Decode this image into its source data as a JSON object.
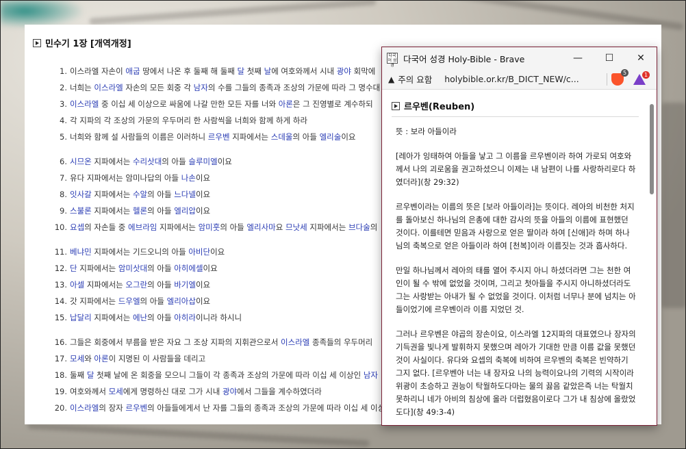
{
  "main": {
    "chapter_title": "민수기 1장 [개역개정]",
    "verses": [
      {
        "n": "1.",
        "segs": [
          [
            "이스라엘 자손이 ",
            0
          ],
          [
            "애굽",
            1
          ],
          [
            " 땅에서 나온 후 둘째 해 둘째 ",
            0
          ],
          [
            "달",
            1
          ],
          [
            " 첫째 ",
            0
          ],
          [
            "날",
            1
          ],
          [
            "에 여호와께서 시내 ",
            0
          ],
          [
            "광야",
            1
          ],
          [
            " 회막에",
            0
          ]
        ]
      },
      {
        "n": "2.",
        "segs": [
          [
            "너희는 ",
            0
          ],
          [
            "이스라엘",
            1
          ],
          [
            " 자손의 모든 회중 각 ",
            0
          ],
          [
            "남자",
            1
          ],
          [
            "의 수를 그들의 종족과 조상의 가문에 따라 그 명수대",
            0
          ]
        ]
      },
      {
        "n": "3.",
        "segs": [
          [
            "이스라엘",
            1
          ],
          [
            " 중 이십 세 이상으로 싸움에 나갈 만한 모든 자를 너와 ",
            0
          ],
          [
            "아론",
            1
          ],
          [
            "은 그 진영별로 계수하되",
            0
          ]
        ]
      },
      {
        "n": "4.",
        "segs": [
          [
            "각 지파의 각 조상의 가문의 우두머리 한 사람씩을 너희와 함께 하게 하라",
            0
          ]
        ]
      },
      {
        "n": "5.",
        "segs": [
          [
            "너희와 함께 설 사람들의 이름은 이러하니 ",
            0
          ],
          [
            "르우벤",
            1
          ],
          [
            " 지파에서는 ",
            0
          ],
          [
            "스데울",
            1
          ],
          [
            "의 아들 ",
            0
          ],
          [
            "엘리술",
            1
          ],
          [
            "이요",
            0
          ]
        ]
      },
      {
        "n": "6.",
        "segs": [
          [
            "시므온",
            1
          ],
          [
            " 지파에서는 ",
            0
          ],
          [
            "수리삿대",
            1
          ],
          [
            "의 아들 ",
            0
          ],
          [
            "슬루미엘",
            1
          ],
          [
            "이요",
            0
          ]
        ]
      },
      {
        "n": "7.",
        "segs": [
          [
            "유다 지파에서는 암미나답의 아들 ",
            0
          ],
          [
            "나손",
            1
          ],
          [
            "이요",
            0
          ]
        ]
      },
      {
        "n": "8.",
        "segs": [
          [
            "잇사갈",
            1
          ],
          [
            " 지파에서는 ",
            0
          ],
          [
            "수알",
            1
          ],
          [
            "의 아들 ",
            0
          ],
          [
            "느다넬",
            1
          ],
          [
            "이요",
            0
          ]
        ]
      },
      {
        "n": "9.",
        "segs": [
          [
            "스불론",
            1
          ],
          [
            " 지파에서는 ",
            0
          ],
          [
            "헬론",
            1
          ],
          [
            "의 아들 ",
            0
          ],
          [
            "엘리압",
            1
          ],
          [
            "이요",
            0
          ]
        ]
      },
      {
        "n": "10.",
        "segs": [
          [
            "요셉",
            1
          ],
          [
            "의 자손들 중 ",
            0
          ],
          [
            "에브라임",
            1
          ],
          [
            " 지파에서는 ",
            0
          ],
          [
            "암미훗",
            1
          ],
          [
            "의 아들 ",
            0
          ],
          [
            "엘리사마",
            1
          ],
          [
            "요 ",
            0
          ],
          [
            "므낫세",
            1
          ],
          [
            " 지파에서는 ",
            0
          ],
          [
            "브다술",
            1
          ],
          [
            "의",
            0
          ]
        ]
      },
      {
        "n": "11.",
        "segs": [
          [
            "베냐민",
            1
          ],
          [
            " 지파에서는 기드오니의 아들 ",
            0
          ],
          [
            "아비단",
            1
          ],
          [
            "이요",
            0
          ]
        ]
      },
      {
        "n": "12.",
        "segs": [
          [
            "단",
            1
          ],
          [
            " 지파에서는 ",
            0
          ],
          [
            "암미삿대",
            1
          ],
          [
            "의 아들 ",
            0
          ],
          [
            "아히에셀",
            1
          ],
          [
            "이요",
            0
          ]
        ]
      },
      {
        "n": "13.",
        "segs": [
          [
            "아셀",
            1
          ],
          [
            " 지파에서는 ",
            0
          ],
          [
            "오그란",
            1
          ],
          [
            "의 아들 ",
            0
          ],
          [
            "바기엘",
            1
          ],
          [
            "이요",
            0
          ]
        ]
      },
      {
        "n": "14.",
        "segs": [
          [
            "갓 지파에서는 ",
            0
          ],
          [
            "드우엘",
            1
          ],
          [
            "의 아들 ",
            0
          ],
          [
            "엘리아삽",
            1
          ],
          [
            "이요",
            0
          ]
        ]
      },
      {
        "n": "15.",
        "segs": [
          [
            "납달리",
            1
          ],
          [
            " 지파에서는 ",
            0
          ],
          [
            "에난",
            1
          ],
          [
            "의 아들 ",
            0
          ],
          [
            "아히라",
            1
          ],
          [
            "이니라 하시니",
            0
          ]
        ]
      },
      {
        "n": "16.",
        "segs": [
          [
            "그들은 회중에서 부름을 받은 자요 그 조상 지파의 지휘관으로서 ",
            0
          ],
          [
            "이스라엘",
            1
          ],
          [
            " 종족들의 우두머리",
            0
          ]
        ]
      },
      {
        "n": "17.",
        "segs": [
          [
            "모세",
            1
          ],
          [
            "와 ",
            0
          ],
          [
            "아론",
            1
          ],
          [
            "이 지명된 이 사람들을 데리고",
            0
          ]
        ]
      },
      {
        "n": "18.",
        "segs": [
          [
            "둘째 ",
            0
          ],
          [
            "달",
            1
          ],
          [
            " 첫째 날에 온 회중을 모으니 그들이 각 종족과 조상의 가문에 따라 이십 세 이상인 ",
            0
          ],
          [
            "남자",
            1
          ]
        ]
      },
      {
        "n": "19.",
        "segs": [
          [
            "여호와께서 ",
            0
          ],
          [
            "모세",
            1
          ],
          [
            "에게 명령하신 대로 그가 시내 ",
            0
          ],
          [
            "광야",
            1
          ],
          [
            "에서 그들을 계수하였더라",
            0
          ]
        ]
      },
      {
        "n": "20.",
        "segs": [
          [
            "이스라엘",
            1
          ],
          [
            "의 장자 ",
            0
          ],
          [
            "르우벤",
            1
          ],
          [
            "의 아들들에게서 난 자를 그들의 종족과 조상의 가문에 따라 이십 세 이상",
            0
          ]
        ]
      }
    ]
  },
  "popup": {
    "app_icon_text": "다국어 성경",
    "window_title": "다국어 성경 Holy-Bible - Brave",
    "minimize": "—",
    "maximize": "☐",
    "close": "✕",
    "warning_icon": "▲",
    "warning_label": "주의 요함",
    "url": "holybible.or.kr/B_DICT_NEW/c...",
    "shield_badge": "5",
    "rewards_badge": "1",
    "entry_title": "르우벤(Reuben)",
    "paragraphs": [
      "뜻 : 보라 아들이라",
      "[레아가 잉태하여 아들을 낳고 그 이름을 르우벤이라 하여 가로되 여호와께서 나의 괴로움을 권고하셨으니 이제는 내 남편이 나를 사랑하리로다 하였더라](창 29:32)",
      "르우벤이라는 이름의 뜻은 [보라 아들이라]는 뜻이다. 레아의 비천한 처지를 돌아보신 하나님의 은총에 대한 감사의 뜻을 아들의 이름에 표현했던 것이다. 이를테면 믿음과 사랑으로 얻은 딸이라 하여 [신애]라 하며 하나님의 축복으로 얻은 아들이라 하여 [천복]이라 이름짓는 것과 흡사하다.",
      "만일 하나님께서 레아의 태를 열어 주시지 아니 하셨더라면 그는 천한 여인이 될 수 밖에 없었을 것이며, 그리고 첫아들을 주시지 아니하셨더라도 그는 사랑받는 아내가 될 수 없었을 것이다. 이처럼 너무나 분에 넘치는 아들이었기에 르우벤이라 이름 지었던 것.",
      "그러나 르우벤은 야곱의 장손이요, 이스라엘 12지파의 대표였으나 장자의 기득권을 빛나게 발휘하지 못했으며 레아가 기대한 만큼 이름 값을 못했던 것이 사실이다. 유다와 요셉의 축복에 비하여 르우벤의 축복은 빈약하기 그지 없다. [르우벤아 너는 내 장자요 나의 능력이요나의 기력의 시작이라 위광이 초승하고 권능이 탁월하도다마는 물의 끓음 같았은즉 너는 탁월치 못하리니 네가 아비의 침상에 올라 더럽혔음이로다 그가 내 침상에 올랐었도다](창 49:3-4)"
    ]
  },
  "colors": {
    "name_link": "#2a3cb4",
    "popup_border": "#7a2136"
  }
}
